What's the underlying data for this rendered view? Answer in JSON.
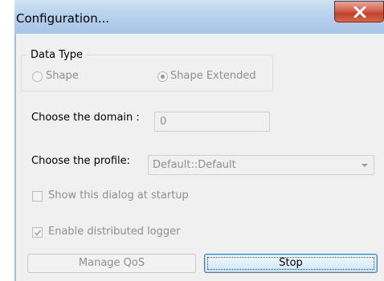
{
  "window": {
    "title": "Configuration...",
    "close_icon": "close-x-icon"
  },
  "data_type": {
    "legend": "Data Type",
    "options": [
      {
        "label": "Shape",
        "selected": false,
        "enabled": false
      },
      {
        "label": "Shape Extended",
        "selected": true,
        "enabled": false
      }
    ]
  },
  "domain": {
    "label": "Choose the domain :",
    "value": "0"
  },
  "profile": {
    "label": "Choose the profile:",
    "selected": "Default::Default"
  },
  "show_dialog": {
    "label": "Show this dialog at startup",
    "checked": false,
    "enabled": false
  },
  "distributed_logger": {
    "label": "Enable distributed logger",
    "checked": true,
    "enabled": false
  },
  "buttons": {
    "manage_qos": "Manage QoS",
    "stop": "Stop"
  },
  "colors": {
    "titlebar": "#b5d0ec",
    "close_button": "#c2422a",
    "client_bg": "#f0f0f0",
    "disabled_text": "#8f8f8f",
    "focus_border": "#3c7fb1"
  }
}
